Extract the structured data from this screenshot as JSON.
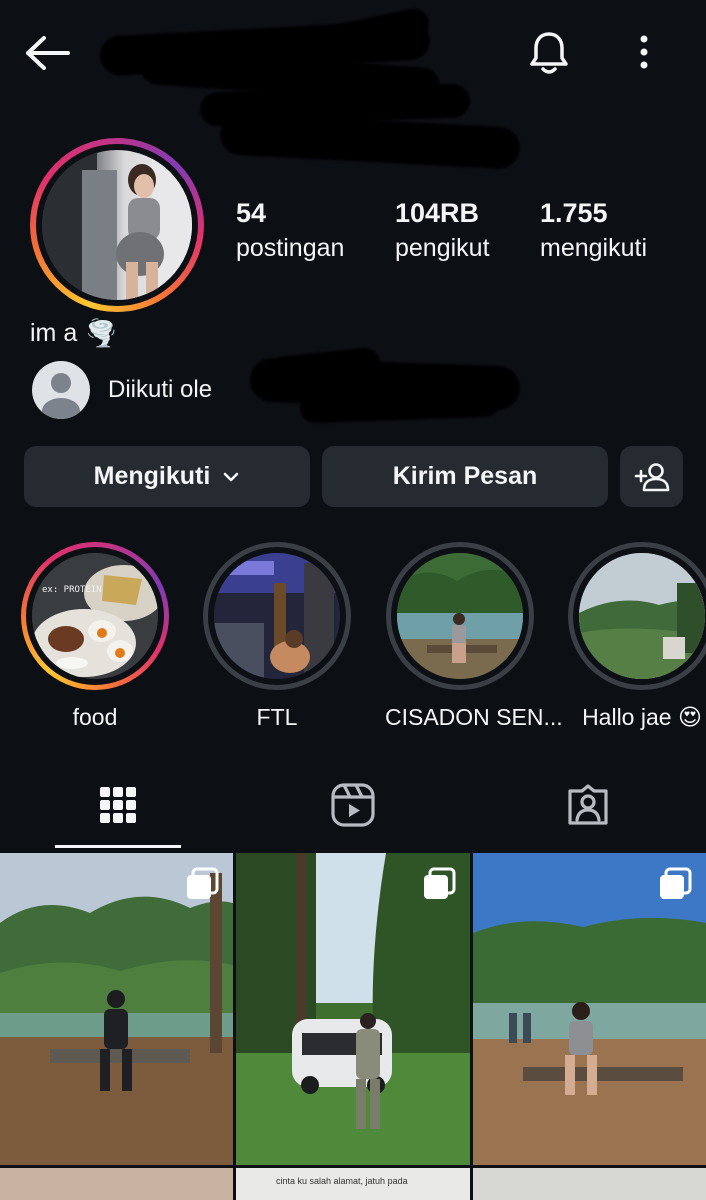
{
  "header": {
    "back_icon": "arrow-left-icon",
    "notification_icon": "bell-icon",
    "more_icon": "more-vertical-icon"
  },
  "profile": {
    "stats": [
      {
        "value": "54",
        "label": "postingan"
      },
      {
        "value": "104RB",
        "label": "pengikut"
      },
      {
        "value": "1.755",
        "label": "mengikuti"
      }
    ],
    "bio": "im a",
    "bio_emoji": "🌪️",
    "followed_by": "Diikuti ole"
  },
  "actions": {
    "following_label": "Mengikuti",
    "message_label": "Kirim Pesan",
    "add_user_icon": "add-person-icon"
  },
  "highlights": [
    {
      "label": "food",
      "state": "new"
    },
    {
      "label": "FTL",
      "state": "seen"
    },
    {
      "label": "CISADON SEN...",
      "state": "seen"
    },
    {
      "label": "Hallo jae 😍",
      "state": "seen"
    }
  ],
  "highlight_food_text": "ex: PROTEIN",
  "tabs": [
    {
      "name": "grid",
      "icon": "grid-icon",
      "active": true
    },
    {
      "name": "reels",
      "icon": "reels-icon",
      "active": false
    },
    {
      "name": "tagged",
      "icon": "tagged-user-icon",
      "active": false
    }
  ],
  "posts_bottom_caption": "cinta ku salah alamat, jatuh pada",
  "colors": {
    "background": "#0c0f14",
    "button": "#262a31",
    "text": "#f4f5f7",
    "story_ring_start": "#fdc830",
    "story_ring_end": "#c13584"
  }
}
